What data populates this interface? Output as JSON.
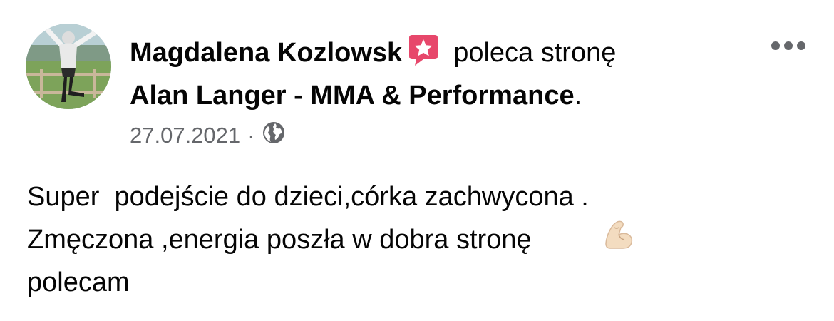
{
  "post": {
    "author": "Magdalena Kozlowsk",
    "action": "poleca stronę",
    "page_name": "Alan Langer - MMA & Performance",
    "page_suffix": ".",
    "date": "27.07.2021",
    "separator": "·",
    "body_lines": [
      "Super  podejście do dzieci,córka zachwycona .",
      "Zmęczona ,energia poszła w dobra stronę",
      "polecam"
    ]
  },
  "icons": {
    "recommendation": "recommend-badge-icon",
    "audience": "globe-icon",
    "menu": "more-options-icon",
    "emoji": "flexed-biceps-emoji-icon"
  },
  "colors": {
    "text_primary": "#050505",
    "text_secondary": "#65676b",
    "recommend_badge": "#e7476b"
  }
}
